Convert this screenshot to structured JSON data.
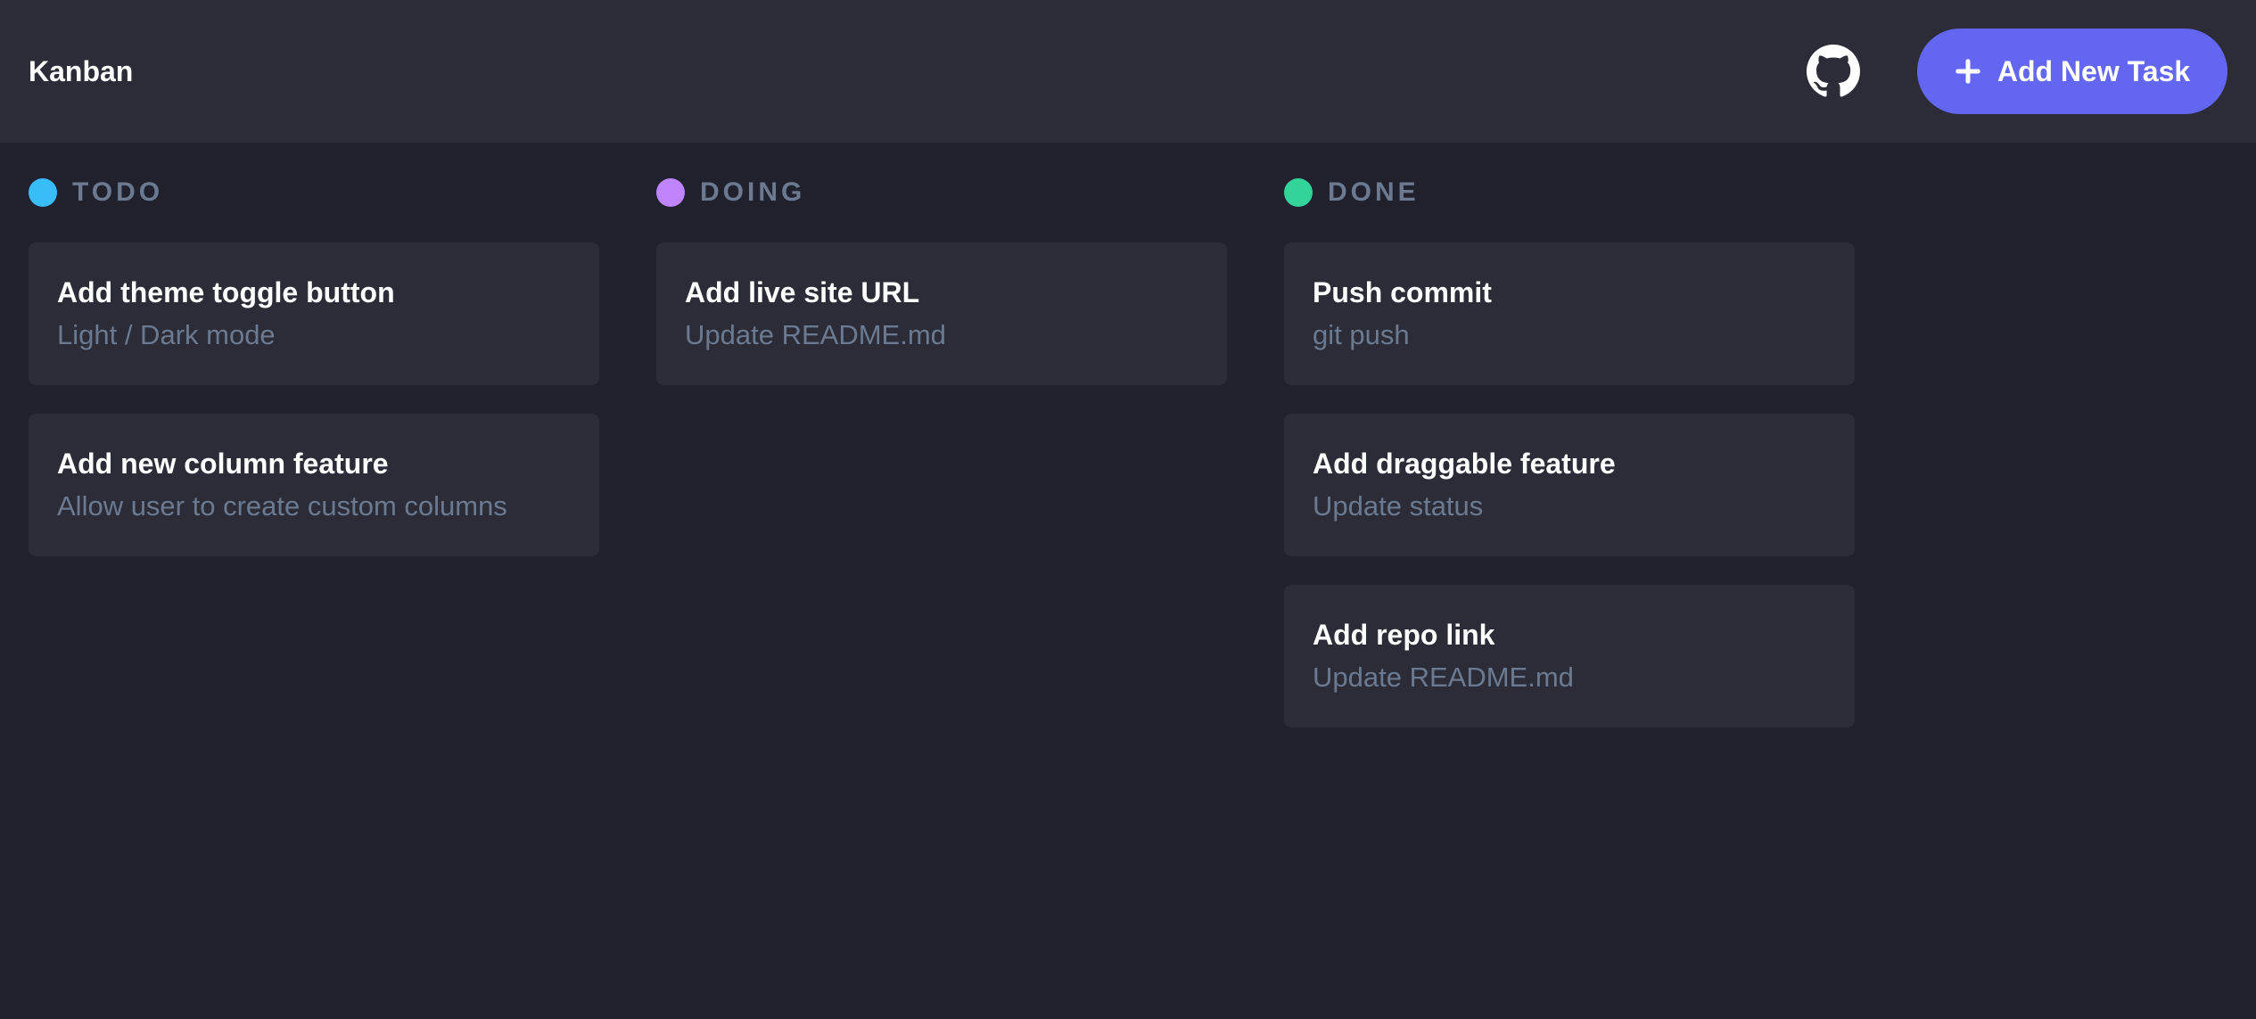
{
  "header": {
    "title": "Kanban",
    "github_icon": "github-icon",
    "add_button_label": "Add New Task",
    "add_button_icon": "plus-icon",
    "accent_color": "#6366f1"
  },
  "columns": [
    {
      "name": "TODO",
      "dot_color": "#38bdf8",
      "tasks": [
        {
          "title": "Add theme toggle button",
          "description": "Light / Dark mode"
        },
        {
          "title": "Add new column feature",
          "description": "Allow user to create custom columns"
        }
      ]
    },
    {
      "name": "DOING",
      "dot_color": "#c084fc",
      "tasks": [
        {
          "title": "Add live site URL",
          "description": "Update README.md"
        }
      ]
    },
    {
      "name": "DONE",
      "dot_color": "#34d399",
      "tasks": [
        {
          "title": "Push commit",
          "description": "git push"
        },
        {
          "title": "Add draggable feature",
          "description": "Update status"
        },
        {
          "title": "Add repo link",
          "description": "Update README.md"
        }
      ]
    }
  ]
}
